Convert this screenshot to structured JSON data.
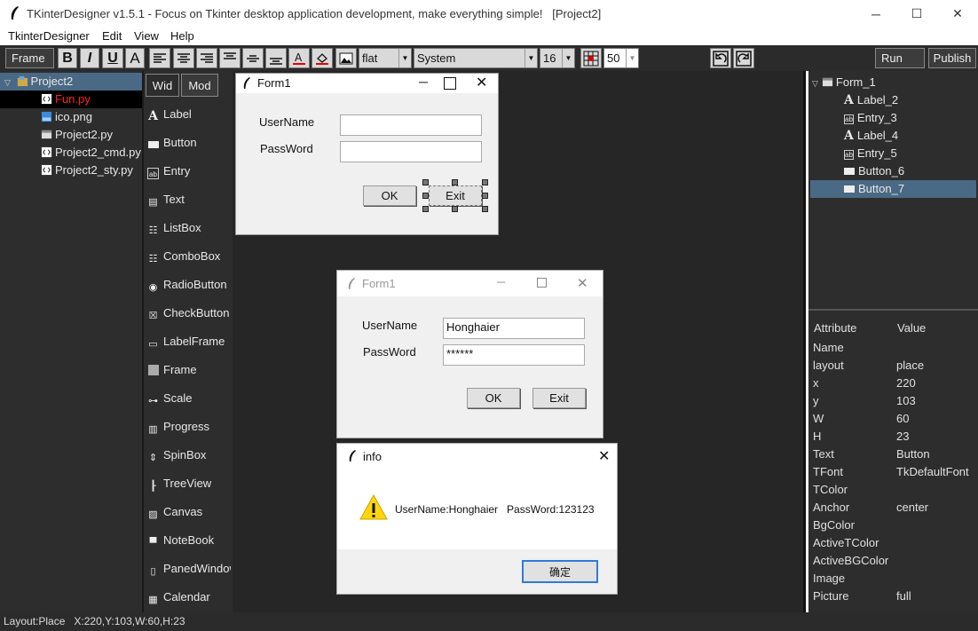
{
  "window": {
    "title": "TKinterDesigner v1.5.1 - Focus on Tkinter desktop application development, make everything simple!   [Project2]",
    "minimize": "─",
    "maximize": "☐",
    "close": "✕"
  },
  "menu": [
    "TkinterDesigner",
    "Edit",
    "View",
    "Help"
  ],
  "toolbar": {
    "frame": "Frame",
    "bold": "B",
    "italic": "I",
    "underline": "U",
    "font_a": "A",
    "relief": "flat",
    "font": "System",
    "size": "16",
    "value": "50",
    "run": "Run",
    "publish": "Publish"
  },
  "project": {
    "root": "Project2",
    "files": [
      {
        "name": "Fun.py",
        "icon": "code-file-icon",
        "selected": true
      },
      {
        "name": "ico.png",
        "icon": "image-file-icon"
      },
      {
        "name": "Project2.py",
        "icon": "window-file-icon"
      },
      {
        "name": "Project2_cmd.py",
        "icon": "code-file-icon"
      },
      {
        "name": "Project2_sty.py",
        "icon": "code-file-icon"
      }
    ]
  },
  "widget_tabs": [
    "Wid",
    "Mod"
  ],
  "widgets": [
    "Label",
    "Button",
    "Entry",
    "Text",
    "ListBox",
    "ComboBox",
    "RadioButton",
    "CheckButton",
    "LabelFrame",
    "Frame",
    "Scale",
    "Progress",
    "SpinBox",
    "TreeView",
    "Canvas",
    "NoteBook",
    "PanedWindow",
    "Calendar"
  ],
  "design_form": {
    "title": "Form1",
    "username_label": "UserName",
    "password_label": "PassWord",
    "ok": "OK",
    "exit": "Exit"
  },
  "run_form": {
    "title": "Form1",
    "username_label": "UserName",
    "password_label": "PassWord",
    "username_value": "Honghaier",
    "password_value": "******",
    "ok": "OK",
    "exit": "Exit"
  },
  "info_dialog": {
    "title": "info",
    "message": "UserName:Honghaier   PassWord:123123",
    "confirm": "确定"
  },
  "outline": {
    "root": "Form_1",
    "items": [
      {
        "name": "Label_2",
        "icon": "label-icon"
      },
      {
        "name": "Entry_3",
        "icon": "entry-icon"
      },
      {
        "name": "Label_4",
        "icon": "label-icon"
      },
      {
        "name": "Entry_5",
        "icon": "entry-icon"
      },
      {
        "name": "Button_6",
        "icon": "button-icon"
      },
      {
        "name": "Button_7",
        "icon": "button-icon",
        "selected": true
      }
    ]
  },
  "attributes": {
    "header_attr": "Attribute",
    "header_value": "Value",
    "rows": [
      [
        "Name",
        ""
      ],
      [
        "layout",
        "place"
      ],
      [
        "x",
        "220"
      ],
      [
        "y",
        "103"
      ],
      [
        "W",
        "60"
      ],
      [
        "H",
        "23"
      ],
      [
        "Text",
        "Button"
      ],
      [
        "TFont",
        "TkDefaultFont"
      ],
      [
        "TColor",
        ""
      ],
      [
        "Anchor",
        "center"
      ],
      [
        "BgColor",
        ""
      ],
      [
        "ActiveTColor",
        ""
      ],
      [
        "ActiveBGColor",
        ""
      ],
      [
        "Image",
        ""
      ],
      [
        "Picture",
        "full"
      ]
    ]
  },
  "status": "Layout:Place   X:220,Y:103,W:60,H:23",
  "colors": {
    "selected": "#4a6984",
    "accent_red": "#ff2020",
    "canvas": "#262626"
  }
}
